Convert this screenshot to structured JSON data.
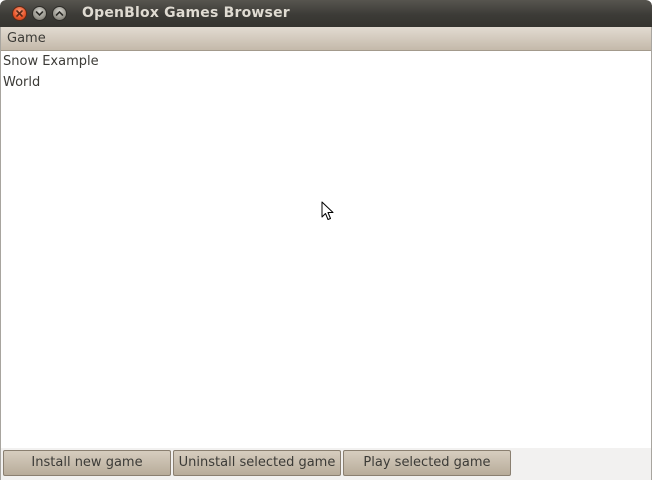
{
  "window": {
    "title": "OpenBlox Games Browser",
    "controls": {
      "close_icon": "close-icon",
      "minimize_icon": "minimize-icon",
      "maximize_icon": "maximize-icon"
    }
  },
  "table": {
    "column_header": "Game",
    "rows": [
      {
        "name": "Snow Example"
      },
      {
        "name": "World"
      }
    ]
  },
  "buttons": {
    "install": "Install new game",
    "uninstall": "Uninstall selected game",
    "play": "Play selected game"
  },
  "colors": {
    "titlebar": "#3c3b37",
    "close_button": "#e9572c",
    "header": "#c4b9aa",
    "button": "#c7bcab",
    "window_bg": "#f2f1f0"
  }
}
